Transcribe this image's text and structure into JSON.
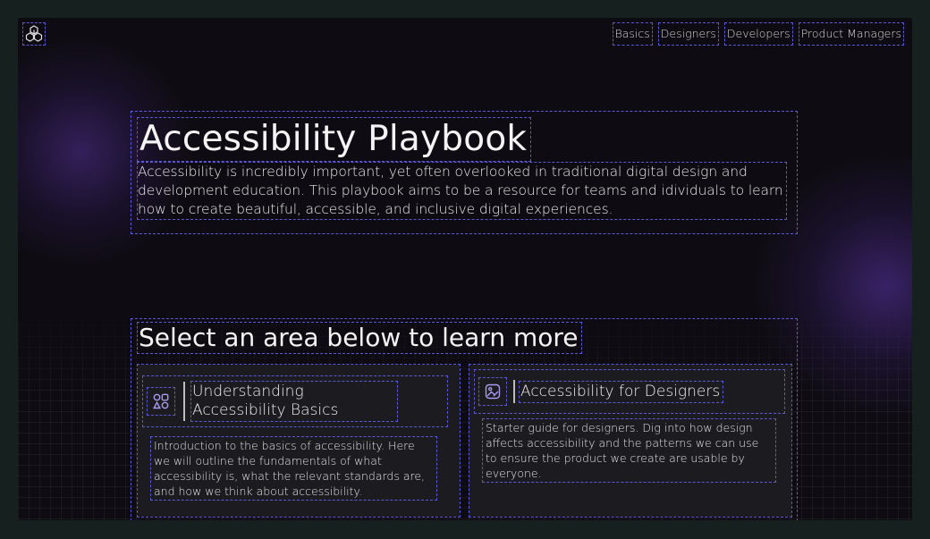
{
  "nav": {
    "items": [
      {
        "label": "Basics"
      },
      {
        "label": "Designers"
      },
      {
        "label": "Developers"
      },
      {
        "label": "Product Managers"
      }
    ]
  },
  "hero": {
    "title": "Accessibility Playbook",
    "description": "Accessibility is incredibly important, yet often overlooked in traditional digital design and development education. This playbook aims to be a resource for teams and idividuals to learn how to create beautiful, accessible, and inclusive digital experiences."
  },
  "areas": {
    "heading": "Select an area below to learn more",
    "cards": [
      {
        "icon": "shapes-icon",
        "title": "Understanding Accessibility Basics",
        "description": "Introduction to the basics of accessibility. Here we will outline the fundamentals of what accessibility is, what the relevant standards are, and how we think about accessibility."
      },
      {
        "icon": "image-edit-icon",
        "title": "Accessibility for Designers",
        "description": "Starter guide for designers. Dig into how design affects accessibility and the patterns we can use to ensure the product we create are usable by everyone."
      }
    ]
  },
  "colors": {
    "background": "#0e0c12",
    "outline": "#5a5ad6",
    "card": "#1c1b20",
    "icon_accent": "#a89cf0"
  }
}
